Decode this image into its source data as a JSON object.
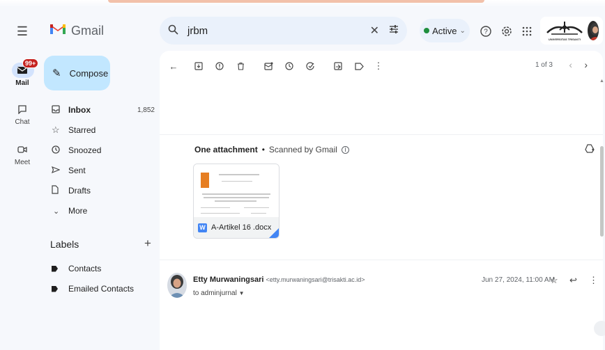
{
  "app": {
    "name": "Gmail"
  },
  "search": {
    "query": "jrbm"
  },
  "status": {
    "label": "Active"
  },
  "rail": {
    "mail_label": "Mail",
    "mail_badge": "99+",
    "chat_label": "Chat",
    "meet_label": "Meet"
  },
  "compose": {
    "label": "Compose"
  },
  "nav": {
    "items": [
      {
        "label": "Inbox",
        "count": "1,852"
      },
      {
        "label": "Starred"
      },
      {
        "label": "Snoozed"
      },
      {
        "label": "Sent"
      },
      {
        "label": "Drafts"
      },
      {
        "label": "More"
      }
    ]
  },
  "labels": {
    "title": "Labels",
    "items": [
      {
        "label": "Contacts"
      },
      {
        "label": "Emailed Contacts"
      }
    ]
  },
  "org": {
    "logo_text": "UNIVERSITAS TRISAKTI"
  },
  "pager": {
    "text": "1 of 3"
  },
  "attachments": {
    "title": "One attachment",
    "scanned": "Scanned by Gmail",
    "file_name": "A-Artikel 16 .docx"
  },
  "message": {
    "sender_name": "Etty Murwaningsari",
    "sender_email": "<etty.murwaningsari@trisakti.ac.id>",
    "to": "to adminjurnal",
    "date": "Jun 27, 2024, 11:00 AM"
  },
  "colors": {
    "compose_bg": "#c2e7ff",
    "status_green": "#1e8e3e",
    "badge_red": "#c5221f",
    "word_blue": "#4285f4"
  }
}
